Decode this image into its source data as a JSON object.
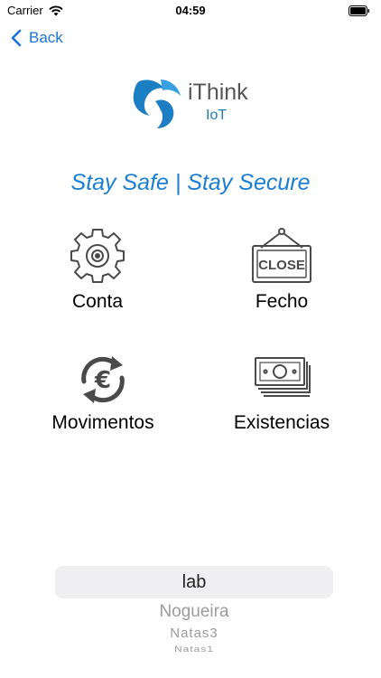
{
  "status": {
    "carrier": "Carrier",
    "time": "04:59"
  },
  "nav": {
    "back_label": "Back"
  },
  "logo": {
    "brand": "iThink",
    "sub": "IoT",
    "icon": "ithink-logo"
  },
  "tagline": "Stay Safe | Stay Secure",
  "tiles": [
    {
      "label": "Conta",
      "icon": "gear-icon"
    },
    {
      "label": "Fecho",
      "icon": "close-sign-icon",
      "sign_text": "CLOSE"
    },
    {
      "label": "Movimentos",
      "icon": "euro-exchange-icon",
      "symbol": "€"
    },
    {
      "label": "Existencias",
      "icon": "money-stack-icon"
    }
  ],
  "picker": {
    "selected": "lab",
    "options": [
      "Nogueira",
      "Natas3",
      "Natas1"
    ]
  },
  "colors": {
    "accent": "#1a73d9",
    "tagline": "#1a7fd4",
    "icon": "#4a4a4a"
  }
}
